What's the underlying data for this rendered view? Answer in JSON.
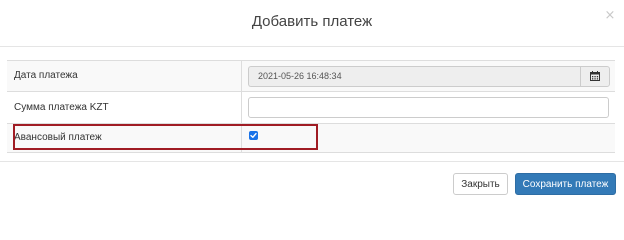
{
  "dialog": {
    "title": "Добавить платеж",
    "close_symbol": "×"
  },
  "form": {
    "rows": [
      {
        "label": "Дата платежа",
        "value": "2021-05-26 16:48:34",
        "type": "datetime",
        "disabled": true,
        "addon_icon": "calendar-icon"
      },
      {
        "label": "Сумма платежа KZT",
        "value": "",
        "type": "text"
      },
      {
        "label": "Авансовый платеж",
        "checked": true,
        "type": "checkbox"
      }
    ]
  },
  "highlight": {
    "target": "advance-payment-row",
    "color": "#a01c24"
  },
  "footer": {
    "close_label": "Закрыть",
    "save_label": "Сохранить платеж"
  },
  "colors": {
    "primary": "#337ab7",
    "checkbox": "#1a73e8",
    "highlight": "#a01c24"
  }
}
